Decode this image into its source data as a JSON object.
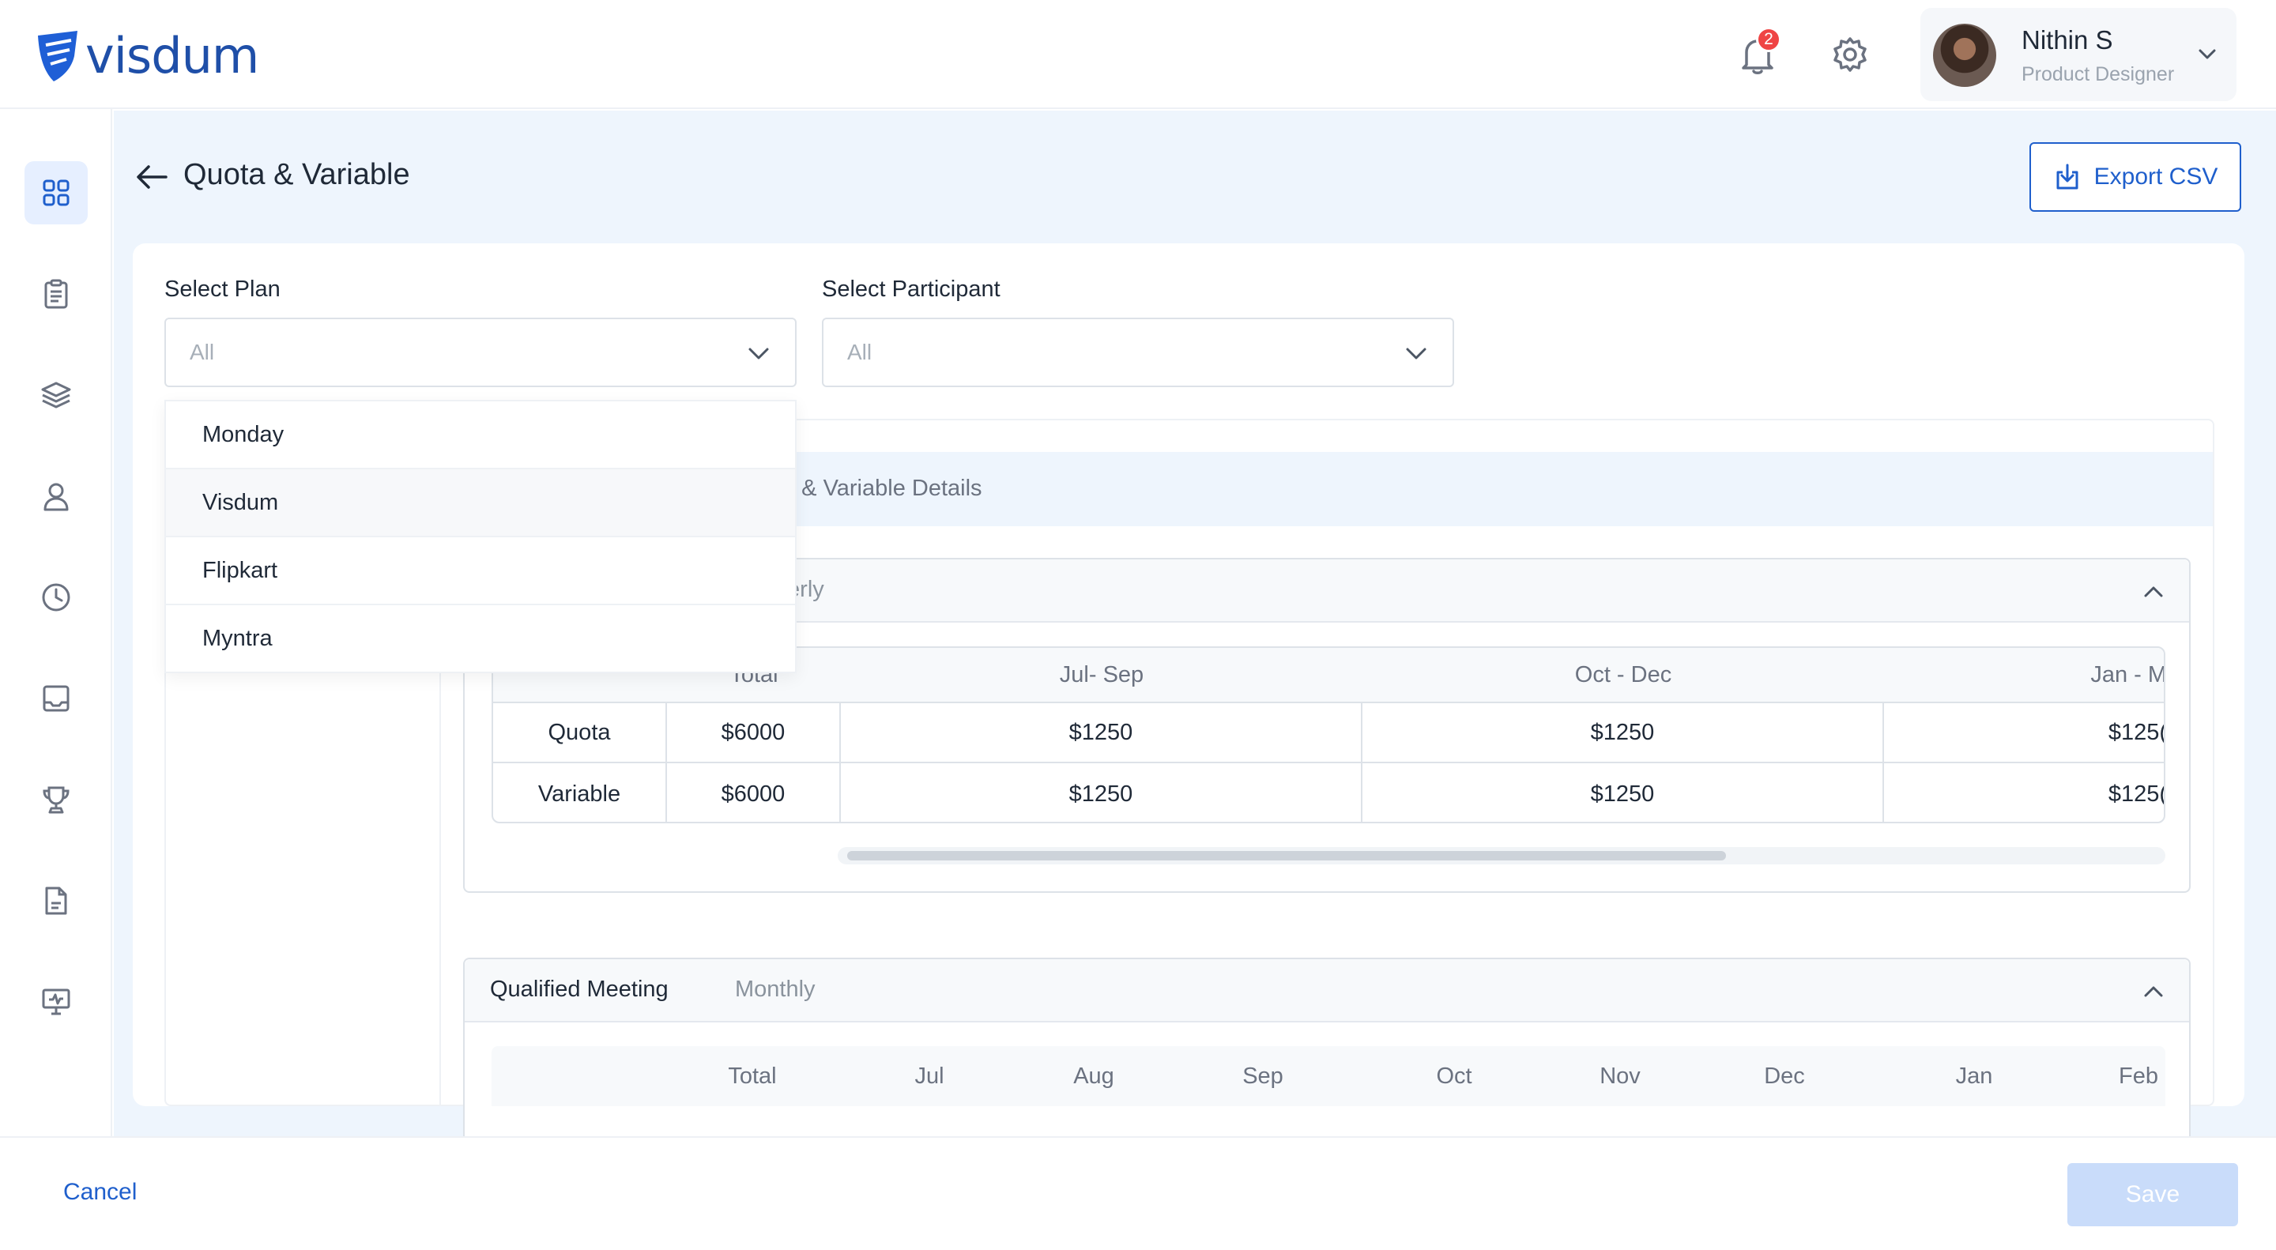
{
  "brand": {
    "name": "visdum",
    "color": "#1f4fa8"
  },
  "header": {
    "notification_count": "2",
    "user": {
      "name": "Nithin S",
      "role": "Product Designer"
    }
  },
  "sidebar": {
    "items": [
      {
        "icon": "grid-icon",
        "active": true
      },
      {
        "icon": "clipboard-icon"
      },
      {
        "icon": "layers-icon"
      },
      {
        "icon": "user-icon"
      },
      {
        "icon": "clock-icon"
      },
      {
        "icon": "inbox-icon"
      },
      {
        "icon": "trophy-icon"
      },
      {
        "icon": "document-icon"
      },
      {
        "icon": "monitor-icon"
      }
    ]
  },
  "page": {
    "title": "Quota & Variable",
    "export_label": "Export CSV"
  },
  "filters": {
    "plan": {
      "label": "Select Plan",
      "value": "All"
    },
    "participant": {
      "label": "Select Participant",
      "value": "All"
    }
  },
  "plan_dropdown": {
    "options": [
      "Monday",
      "Visdum",
      "Flipkart",
      "Myntra"
    ],
    "hovered": "Visdum"
  },
  "details": {
    "title_visible": "a & Variable Details",
    "quarterly_card": {
      "period_visible": "terly",
      "columns": [
        "Total",
        "Jul- Sep",
        "Oct - Dec",
        "Jan - M"
      ],
      "rows": [
        {
          "label": "Quota",
          "total": "$6000",
          "values": [
            "$1250",
            "$1250",
            "$125("
          ]
        },
        {
          "label": "Variable",
          "total": "$6000",
          "values": [
            "$1250",
            "$1250",
            "$125("
          ]
        }
      ]
    },
    "meeting_card": {
      "title": "Qualified Meeting",
      "period": "Monthly",
      "columns": [
        "Total",
        "Jul",
        "Aug",
        "Sep",
        "Oct",
        "Nov",
        "Dec",
        "Jan",
        "Feb"
      ]
    }
  },
  "footer": {
    "cancel_label": "Cancel",
    "save_label": "Save"
  },
  "colors": {
    "accent": "#1f5fcc",
    "badge": "#ef4444",
    "save_disabled": "#c9dcfa"
  }
}
